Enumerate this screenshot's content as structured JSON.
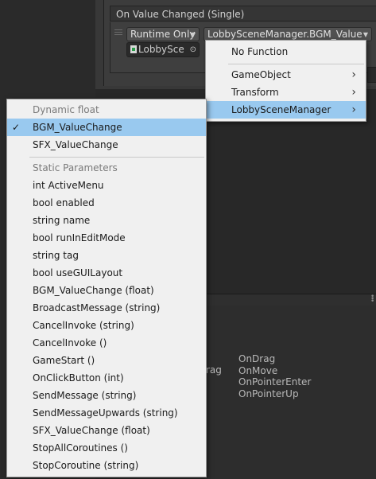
{
  "event": {
    "header": "On Value Changed (Single)",
    "runtime_dropdown": "Runtime Only",
    "function_dropdown": "LobbySceneManager.BGM_Value",
    "object_field": "LobbySce"
  },
  "function_menu": {
    "items": [
      {
        "label": "No Function",
        "submenu": false
      },
      {
        "label": "GameObject",
        "submenu": true
      },
      {
        "label": "Transform",
        "submenu": true
      },
      {
        "label": "LobbySceneManager",
        "submenu": true,
        "highlighted": true
      }
    ]
  },
  "method_menu": {
    "dynamic_header": "Dynamic float",
    "dynamic_items": [
      "BGM_ValueChange",
      "SFX_ValueChange"
    ],
    "selected": "BGM_ValueChange",
    "static_header": "Static Parameters",
    "static_items": [
      "int ActiveMenu",
      "bool enabled",
      "string name",
      "bool runInEditMode",
      "string tag",
      "bool useGUILayout",
      "BGM_ValueChange (float)",
      "BroadcastMessage (string)",
      "CancelInvoke (string)",
      "CancelInvoke ()",
      "GameStart ()",
      "OnClickButton (int)",
      "SendMessage (string)",
      "SendMessageUpwards (string)",
      "SFX_ValueChange (float)",
      "StopAllCoroutines ()",
      "StopCoroutine (string)"
    ]
  },
  "background_events": {
    "partial_left": "rag",
    "items": [
      "OnDrag",
      "OnMove",
      "OnPointerEnter",
      "OnPointerUp"
    ]
  },
  "colors": {
    "menu_bg": "#f0f0f0",
    "selection": "#99c9ef",
    "editor_bg": "#282828"
  }
}
